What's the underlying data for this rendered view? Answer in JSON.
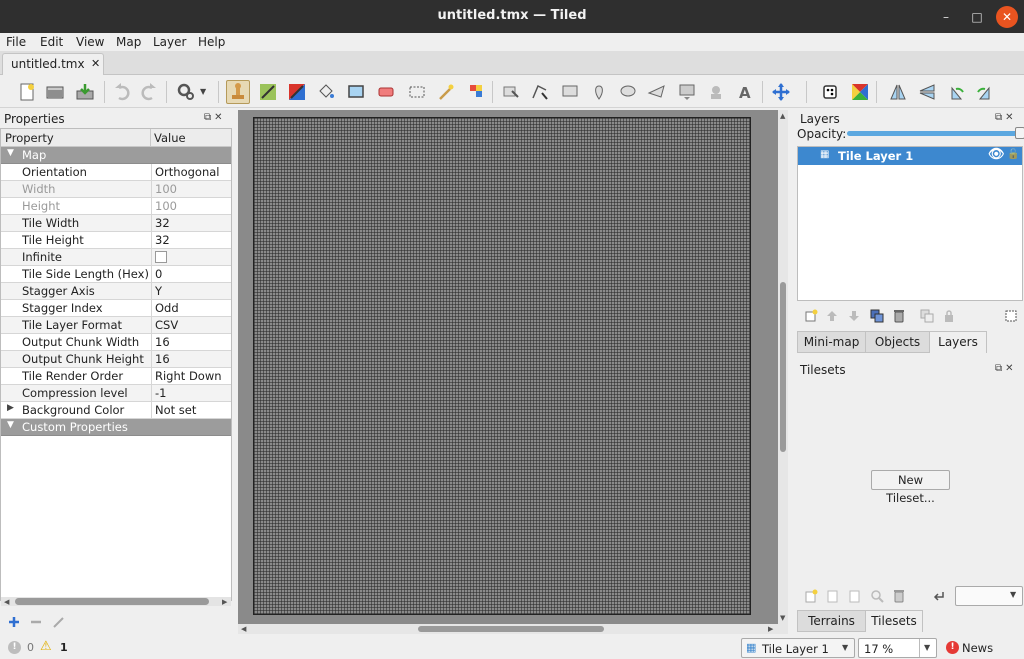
{
  "window": {
    "title": "untitled.tmx — Tiled",
    "minimize": "–",
    "maximize": "□",
    "close": "✕"
  },
  "menu": [
    "File",
    "Edit",
    "View",
    "Map",
    "Layer",
    "Help"
  ],
  "document_tab": {
    "label": "untitled.tmx",
    "close": "✕"
  },
  "toolbar": {
    "icons": [
      "new-file-icon",
      "open-file-icon",
      "save-file-icon",
      "undo-icon",
      "redo-icon",
      "commands-icon",
      "stamp-brush-icon",
      "terrain-brush-icon",
      "wang-brush-icon",
      "bucket-fill-icon",
      "shape-fill-icon",
      "eraser-icon",
      "rectangular-select-icon",
      "magic-wand-icon",
      "select-same-tile-icon",
      "select-objects-icon",
      "edit-polygons-icon",
      "insert-rectangle-icon",
      "insert-point-icon",
      "insert-ellipse-icon",
      "insert-polygon-icon",
      "insert-tile-icon",
      "insert-template-icon",
      "insert-text-icon",
      "move-icon",
      "random-mode-icon",
      "wang-fill-mode-icon",
      "flip-horizontal-icon",
      "flip-vertical-icon",
      "rotate-left-icon",
      "rotate-right-icon"
    ],
    "active": "stamp-brush-icon"
  },
  "properties_panel": {
    "title": "Properties",
    "col_property": "Property",
    "col_value": "Value",
    "group_map": "Map",
    "rows": [
      {
        "key": "Orientation",
        "value": "Orthogonal",
        "grey": false
      },
      {
        "key": "Width",
        "value": "100",
        "grey": true
      },
      {
        "key": "Height",
        "value": "100",
        "grey": true
      },
      {
        "key": "Tile Width",
        "value": "32",
        "grey": false
      },
      {
        "key": "Tile Height",
        "value": "32",
        "grey": false
      },
      {
        "key": "Infinite",
        "value": "",
        "grey": false,
        "checkbox": true
      },
      {
        "key": "Tile Side Length (Hex)",
        "value": "0",
        "grey": false
      },
      {
        "key": "Stagger Axis",
        "value": "Y",
        "grey": false
      },
      {
        "key": "Stagger Index",
        "value": "Odd",
        "grey": false
      },
      {
        "key": "Tile Layer Format",
        "value": "CSV",
        "grey": false
      },
      {
        "key": "Output Chunk Width",
        "value": "16",
        "grey": false
      },
      {
        "key": "Output Chunk Height",
        "value": "16",
        "grey": false
      },
      {
        "key": "Tile Render Order",
        "value": "Right Down",
        "grey": false
      },
      {
        "key": "Compression level",
        "value": "-1",
        "grey": false
      },
      {
        "key": "Background Color",
        "value": "Not set",
        "grey": false,
        "expandable": true
      }
    ],
    "group_custom": "Custom Properties"
  },
  "layers_panel": {
    "title": "Layers",
    "opacity_label": "Opacity:",
    "opacity_value": 1.0,
    "layers": [
      {
        "name": "Tile Layer 1",
        "visible": true
      }
    ]
  },
  "dock_tabs": [
    "Mini-map",
    "Objects",
    "Layers"
  ],
  "dock_tabs_selected": "Layers",
  "tilesets_panel": {
    "title": "Tilesets",
    "new_button": "New Tileset...",
    "tabs": [
      "Terrains",
      "Tilesets"
    ],
    "selected_tab": "Tilesets"
  },
  "statusbar": {
    "errors": "0",
    "warnings": "1",
    "current_layer": "Tile Layer 1",
    "zoom": "17 %",
    "news": "News"
  },
  "colors": {
    "accent": "#3d88cf",
    "titlebar": "#2f2f2f",
    "close": "#e95420",
    "active_tool": "#e7d9b4"
  }
}
